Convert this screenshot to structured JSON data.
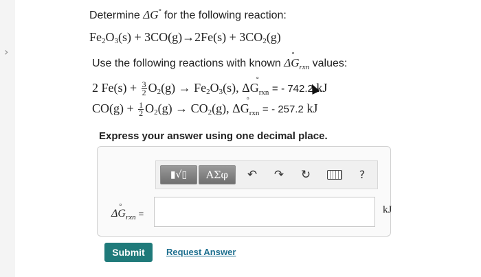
{
  "nav": {
    "chevron": "›"
  },
  "question": {
    "intro": "Determine",
    "target_symbol": "ΔG",
    "target_degree": "°",
    "intro_tail": "for the following reaction:",
    "overall_reaction": {
      "p1": "Fe",
      "p1_sub": "2",
      "p2": "O",
      "p2_sub": "3",
      "p3": "(s) + 3CO(g)→2Fe(s) + 3CO",
      "p3_sub": "2",
      "p4": "(g)"
    },
    "use_text": "Use the following reactions with known",
    "use_tail": "values:",
    "rxn_symbol": "ΔG",
    "rxn_deg": "°",
    "rxn_sub": "rxn",
    "reaction1": {
      "lhs": "2 Fe(s) +",
      "frac_num": "3",
      "frac_den": "2",
      "mid": "O",
      "mid_sub": "2",
      "rhs_a": "(g) → Fe",
      "rhs_sub1": "2",
      "rhs_b": "O",
      "rhs_sub2": "3",
      "rhs_c": "(s), ΔG",
      "eq": "=",
      "value": "- 742.2",
      "unit": "kJ"
    },
    "reaction2": {
      "lhs": "CO(g) +",
      "frac_num": "1",
      "frac_den": "2",
      "mid": "O",
      "mid_sub": "2",
      "rhs_a": "(g) → CO",
      "rhs_sub": "2",
      "rhs_b": "(g), ΔG",
      "eq": "=",
      "value": "- 257.2",
      "unit": "kJ"
    },
    "instruction": "Express your answer using one decimal place."
  },
  "toolbar": {
    "template_label": "▮√▯",
    "greek_label": "ΑΣφ",
    "undo_icon": "undo-icon",
    "redo_icon": "redo-icon",
    "reset_icon": "reset-icon",
    "keyboard_icon": "keyboard-icon",
    "help_label": "?"
  },
  "answer": {
    "label_symbol": "ΔG",
    "label_deg": "°",
    "label_sub": "rxn",
    "label_eq": "=",
    "value": "",
    "placeholder": "",
    "unit": "kJ"
  },
  "actions": {
    "submit": "Submit",
    "request": "Request Answer"
  }
}
